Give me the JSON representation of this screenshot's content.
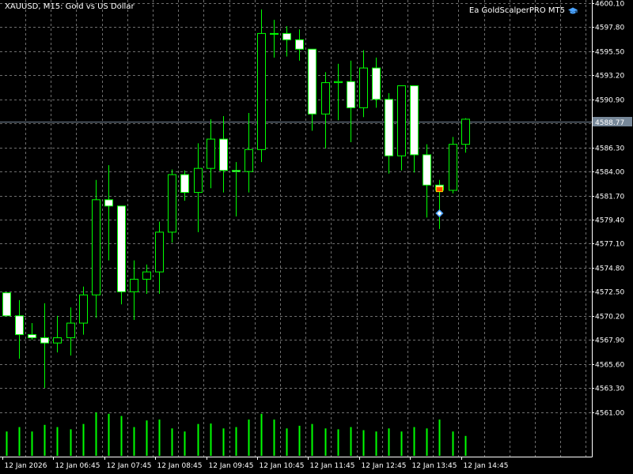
{
  "header": {
    "title": "XAUUSD, M15:  Gold vs US Dollar",
    "expert": "Ea GoldScalperPRO MT5",
    "expert_icon": "graduation-cap-icon"
  },
  "colors": {
    "background": "#000000",
    "grid": "#6e6e6e",
    "axis": "#ffffff",
    "bull_body": "#000000",
    "bear_body": "#ffffff",
    "candle_outline": "#00ff00",
    "volume": "#00ff00",
    "bid_line": "#778899",
    "price_tag_bg": "#778899",
    "buy_marker": "#4aa3ff",
    "sell_marker": "#ff4500"
  },
  "chart_data": {
    "type": "candlestick",
    "symbol": "XAUUSD",
    "timeframe": "M15",
    "current_price": "4588.77",
    "y_ticks": [
      "4600.10",
      "4597.80",
      "4595.50",
      "4593.20",
      "4590.90",
      "4588.60",
      "4586.30",
      "4584.00",
      "4581.70",
      "4579.40",
      "4577.10",
      "4574.80",
      "4572.50",
      "4570.20",
      "4567.90",
      "4565.60",
      "4563.30",
      "4561.00"
    ],
    "y_tick_values": [
      4600.1,
      4597.8,
      4595.5,
      4593.2,
      4590.9,
      4588.6,
      4586.3,
      4584.0,
      4581.7,
      4579.4,
      4577.1,
      4574.8,
      4572.5,
      4570.2,
      4567.9,
      4565.6,
      4563.3,
      4561.0
    ],
    "ylim": [
      4559.0,
      4600.1
    ],
    "x_ticks": [
      "12 Jan 2026",
      "12 Jan 06:45",
      "12 Jan 07:45",
      "12 Jan 08:45",
      "12 Jan 09:45",
      "12 Jan 10:45",
      "12 Jan 11:45",
      "12 Jan 12:45",
      "12 Jan 13:45",
      "12 Jan 14:45"
    ],
    "x_tick_bars": [
      0,
      4,
      8,
      12,
      16,
      20,
      24,
      28,
      32,
      36
    ],
    "grid": true,
    "candles": [
      {
        "o": 4572.4,
        "h": 4572.4,
        "l": 4570.2,
        "c": 4570.2
      },
      {
        "o": 4570.2,
        "h": 4571.7,
        "l": 4566.1,
        "c": 4568.4
      },
      {
        "o": 4568.4,
        "h": 4569.5,
        "l": 4567.9,
        "c": 4568.1
      },
      {
        "o": 4568.1,
        "h": 4571.4,
        "l": 4563.3,
        "c": 4567.6
      },
      {
        "o": 4567.6,
        "h": 4570.2,
        "l": 4566.7,
        "c": 4568.1
      },
      {
        "o": 4568.1,
        "h": 4571.0,
        "l": 4566.4,
        "c": 4569.5
      },
      {
        "o": 4569.5,
        "h": 4573.0,
        "l": 4568.4,
        "c": 4572.2
      },
      {
        "o": 4572.2,
        "h": 4583.2,
        "l": 4570.0,
        "c": 4581.3
      },
      {
        "o": 4581.3,
        "h": 4584.6,
        "l": 4575.5,
        "c": 4580.7
      },
      {
        "o": 4580.7,
        "h": 4580.7,
        "l": 4571.3,
        "c": 4572.5
      },
      {
        "o": 4572.5,
        "h": 4575.5,
        "l": 4569.8,
        "c": 4573.7
      },
      {
        "o": 4573.7,
        "h": 4575.1,
        "l": 4572.3,
        "c": 4574.4
      },
      {
        "o": 4574.4,
        "h": 4579.2,
        "l": 4572.3,
        "c": 4578.2
      },
      {
        "o": 4578.2,
        "h": 4584.2,
        "l": 4577.2,
        "c": 4583.7
      },
      {
        "o": 4583.7,
        "h": 4584.1,
        "l": 4581.2,
        "c": 4582.0
      },
      {
        "o": 4582.0,
        "h": 4586.7,
        "l": 4578.2,
        "c": 4584.3
      },
      {
        "o": 4584.3,
        "h": 4589.0,
        "l": 4582.4,
        "c": 4587.1
      },
      {
        "o": 4587.1,
        "h": 4589.3,
        "l": 4582.0,
        "c": 4584.1
      },
      {
        "o": 4584.1,
        "h": 4584.9,
        "l": 4579.7,
        "c": 4584.0
      },
      {
        "o": 4584.0,
        "h": 4589.6,
        "l": 4582.0,
        "c": 4586.1
      },
      {
        "o": 4586.1,
        "h": 4599.5,
        "l": 4584.9,
        "c": 4597.2
      },
      {
        "o": 4597.2,
        "h": 4598.5,
        "l": 4594.9,
        "c": 4597.2
      },
      {
        "o": 4597.2,
        "h": 4597.9,
        "l": 4595.0,
        "c": 4596.6
      },
      {
        "o": 4596.6,
        "h": 4597.6,
        "l": 4594.6,
        "c": 4595.7
      },
      {
        "o": 4595.7,
        "h": 4595.7,
        "l": 4587.9,
        "c": 4589.5
      },
      {
        "o": 4589.5,
        "h": 4593.5,
        "l": 4586.2,
        "c": 4592.5
      },
      {
        "o": 4592.5,
        "h": 4594.3,
        "l": 4588.9,
        "c": 4592.6
      },
      {
        "o": 4592.6,
        "h": 4594.6,
        "l": 4586.8,
        "c": 4590.1
      },
      {
        "o": 4590.1,
        "h": 4595.6,
        "l": 4589.2,
        "c": 4593.9
      },
      {
        "o": 4593.9,
        "h": 4594.9,
        "l": 4590.1,
        "c": 4590.9
      },
      {
        "o": 4590.9,
        "h": 4591.5,
        "l": 4583.8,
        "c": 4585.5
      },
      {
        "o": 4585.5,
        "h": 4592.2,
        "l": 4584.1,
        "c": 4592.2
      },
      {
        "o": 4592.2,
        "h": 4592.2,
        "l": 4583.9,
        "c": 4585.6
      },
      {
        "o": 4585.6,
        "h": 4586.6,
        "l": 4579.6,
        "c": 4582.7
      },
      {
        "o": 4582.7,
        "h": 4583.2,
        "l": 4578.5,
        "c": 4582.2
      },
      {
        "o": 4582.2,
        "h": 4587.3,
        "l": 4581.9,
        "c": 4586.6
      },
      {
        "o": 4586.6,
        "h": 4589.1,
        "l": 4585.8,
        "c": 4589.0
      }
    ],
    "volumes": [
      0.55,
      0.65,
      0.55,
      0.7,
      0.65,
      0.6,
      0.72,
      0.98,
      0.95,
      0.9,
      0.65,
      0.8,
      0.82,
      0.62,
      0.55,
      0.72,
      0.73,
      0.62,
      0.65,
      0.82,
      0.95,
      0.82,
      0.62,
      0.68,
      0.72,
      0.62,
      0.6,
      0.65,
      0.58,
      0.55,
      0.62,
      0.55,
      0.65,
      0.62,
      0.82,
      0.55,
      0.45
    ],
    "trade_markers": [
      {
        "bar": 34,
        "price": 4582.3,
        "kind": "sell"
      },
      {
        "bar": 34,
        "price": 4580.0,
        "kind": "buy"
      }
    ]
  }
}
